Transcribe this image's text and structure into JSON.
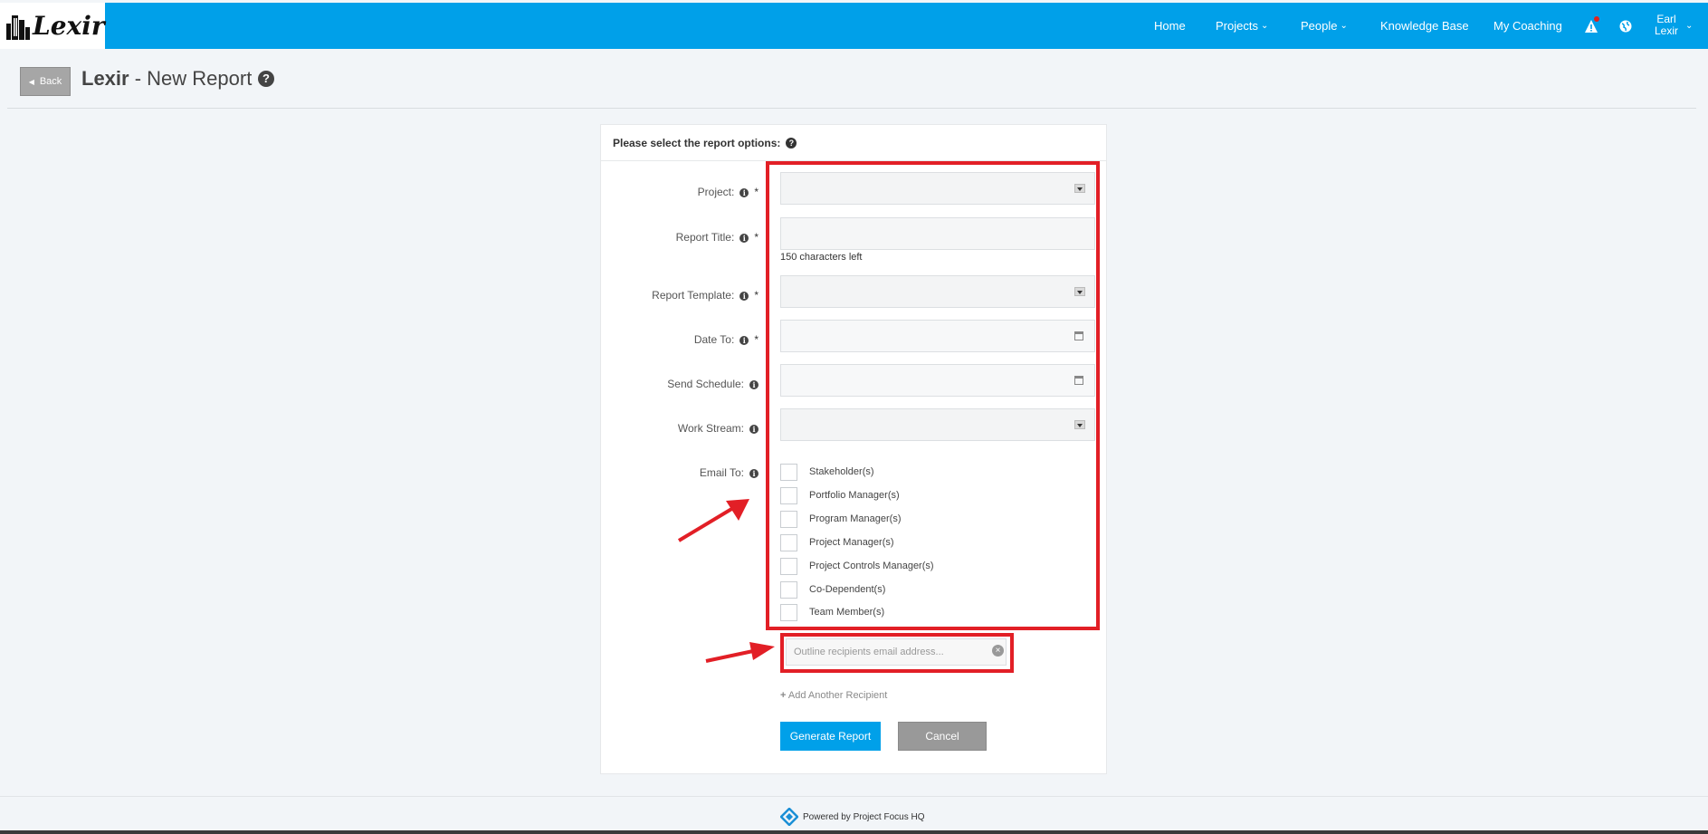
{
  "brand": {
    "name": "Lexir"
  },
  "nav": {
    "items": [
      {
        "label": "Home"
      },
      {
        "label": "Projects"
      },
      {
        "label": "People"
      },
      {
        "label": "Knowledge Base"
      },
      {
        "label": "My Coaching"
      }
    ],
    "user": {
      "first": "Earl",
      "last": "Lexir"
    },
    "colors": {
      "bar": "#00a0e9",
      "alert_dot": "#e0231e"
    }
  },
  "header": {
    "back_label": "Back",
    "title_bold": "Lexir",
    "title_rest": " - New Report"
  },
  "form": {
    "heading": "Please select the report options:",
    "fields": [
      {
        "label": "Project:",
        "required": "*",
        "type": "select",
        "value": ""
      },
      {
        "label": "Report Title:",
        "required": "*",
        "type": "text",
        "value": "",
        "hint": "150 characters left"
      },
      {
        "label": "Report Template:",
        "required": "*",
        "type": "select",
        "value": ""
      },
      {
        "label": "Date To:",
        "required": "*",
        "type": "date",
        "value": ""
      },
      {
        "label": "Send Schedule:",
        "type": "date",
        "value": ""
      },
      {
        "label": "Work Stream:",
        "type": "select",
        "value": ""
      }
    ],
    "email_to": {
      "label": "Email To:",
      "options": [
        "Stakeholder(s)",
        "Portfolio Manager(s)",
        "Program Manager(s)",
        "Project Manager(s)",
        "Project Controls Manager(s)",
        "Co-Dependent(s)",
        "Team Member(s)"
      ]
    },
    "recipient_placeholder": "Outline recipients email address...",
    "add_recipient": "Add Another Recipient",
    "generate_label": "Generate Report",
    "cancel_label": "Cancel"
  },
  "footer": {
    "text": "Powered by Project Focus HQ"
  },
  "annotation_color": "#e21f26"
}
